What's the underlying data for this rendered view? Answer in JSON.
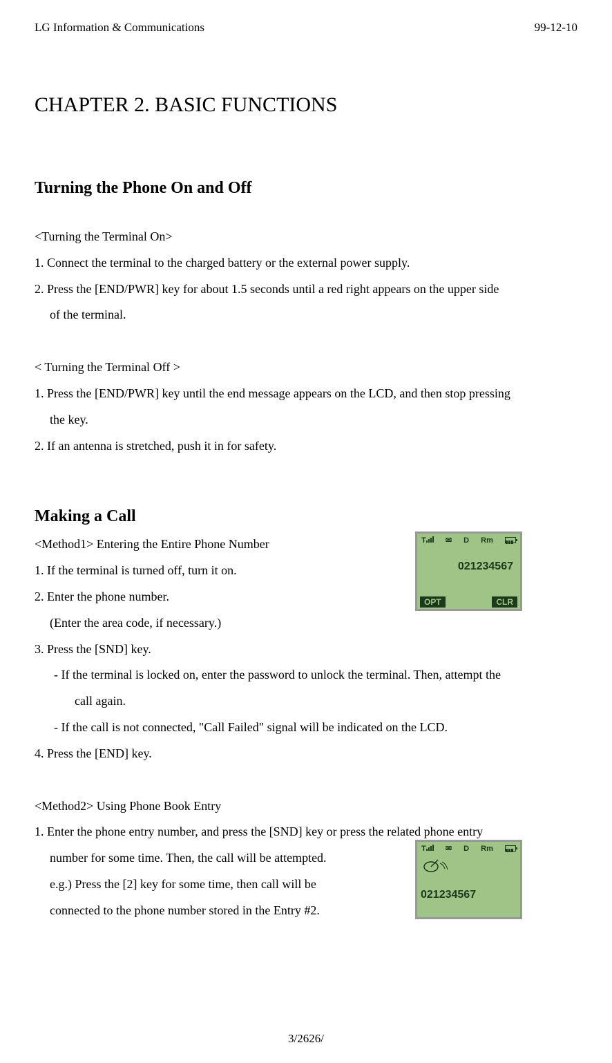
{
  "header": {
    "company": "LG Information & Communications",
    "date": "99-12-10"
  },
  "chapter": {
    "title": "CHAPTER 2. BASIC FUNCTIONS"
  },
  "section1": {
    "title": "Turning the Phone On and Off",
    "sub1_heading": "<Turning the Terminal On>",
    "sub1_item1": "1.  Connect the terminal to the charged battery or the external power supply.",
    "sub1_item2": "2.  Press the [END/PWR] key for about 1.5 seconds until a red right appears on the upper side",
    "sub1_item2_cont": "of the terminal.",
    "sub2_heading": "< Turning the Terminal Off >",
    "sub2_item1": "1. Press the [END/PWR] key until the end message appears on the LCD, and then stop pressing",
    "sub2_item1_cont": "the key.",
    "sub2_item2": "2. If an antenna is stretched, push it in for safety."
  },
  "section2": {
    "title": "Making a Call",
    "method1_heading": "<Method1> Entering the Entire Phone Number",
    "m1_item1": "1. If the terminal is turned off, turn it on.",
    "m1_item2": "2. Enter the phone number.",
    "m1_item2_note": "(Enter the area code, if necessary.)",
    "m1_item3": "3. Press the [SND] key.",
    "m1_sub1": "-    If the terminal is locked on, enter the password to unlock the terminal. Then, attempt the",
    "m1_sub1_cont": "call again.",
    "m1_sub2": "-    If the call is not connected, \"Call Failed\" signal will be indicated on the LCD.",
    "m1_item4": "4. Press the [END] key.",
    "method2_heading": "<Method2> Using Phone Book Entry",
    "m2_item1_line1": "1. Enter the phone entry number, and press the [SND] key or press the related phone entry",
    "m2_item1_line2": "number for some time. Then, the call will be attempted.",
    "m2_item1_line3": "e.g.) Press the [2] key for some time, then call will be",
    "m2_item1_line4": "connected to the phone number stored in the Entry #2."
  },
  "phone1": {
    "signal": "T",
    "icons": {
      "msg": "✉",
      "d": "D",
      "rm": "Rm"
    },
    "number": "021234567",
    "softkey_left": "OPT",
    "softkey_right": "CLR"
  },
  "phone2": {
    "signal": "T",
    "icons": {
      "msg": "✉",
      "d": "D",
      "rm": "Rm"
    },
    "number": "021234567"
  },
  "footer": {
    "page": "3/2626/"
  }
}
